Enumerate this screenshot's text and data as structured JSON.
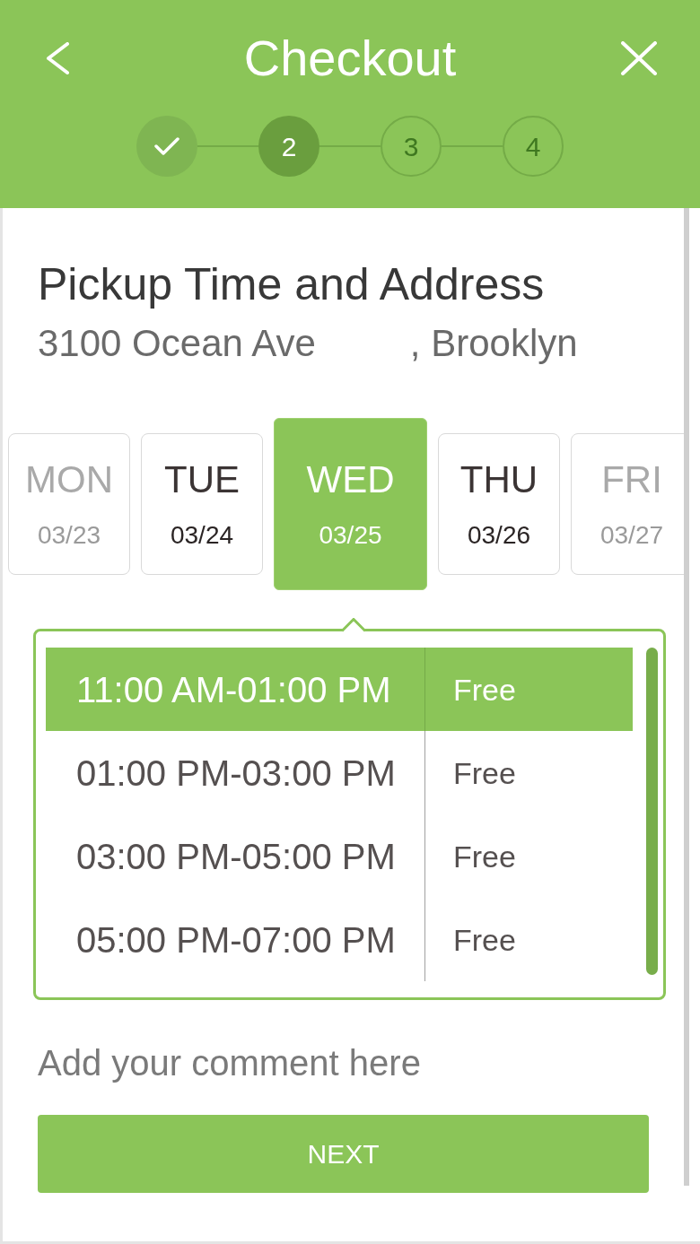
{
  "header": {
    "title": "Checkout"
  },
  "steps": [
    {
      "completed": true,
      "selected": false
    },
    {
      "label": "2",
      "completed": false,
      "selected": true
    },
    {
      "label": "3",
      "completed": false,
      "selected": false
    },
    {
      "label": "4",
      "completed": false,
      "selected": false
    }
  ],
  "section": {
    "title": "Pickup Time and Address",
    "address": "3100 Ocean Ave         , Brooklyn"
  },
  "days": [
    {
      "day": "MON",
      "date": "03/23",
      "selected": false,
      "disabled": true
    },
    {
      "day": "TUE",
      "date": "03/24",
      "selected": false,
      "disabled": false
    },
    {
      "day": "WED",
      "date": "03/25",
      "selected": true,
      "disabled": false
    },
    {
      "day": "THU",
      "date": "03/26",
      "selected": false,
      "disabled": false
    },
    {
      "day": "FRI",
      "date": "03/27",
      "selected": false,
      "disabled": true
    }
  ],
  "time_slots": [
    {
      "time": "11:00 AM-01:00 PM",
      "availability": "Free",
      "selected": true
    },
    {
      "time": "01:00 PM-03:00 PM",
      "availability": "Free",
      "selected": false
    },
    {
      "time": "03:00 PM-05:00 PM",
      "availability": "Free",
      "selected": false
    },
    {
      "time": "05:00 PM-07:00 PM",
      "availability": "Free",
      "selected": false
    }
  ],
  "comment": {
    "placeholder": "Add your comment here"
  },
  "next_button": {
    "label": "NEXT"
  }
}
